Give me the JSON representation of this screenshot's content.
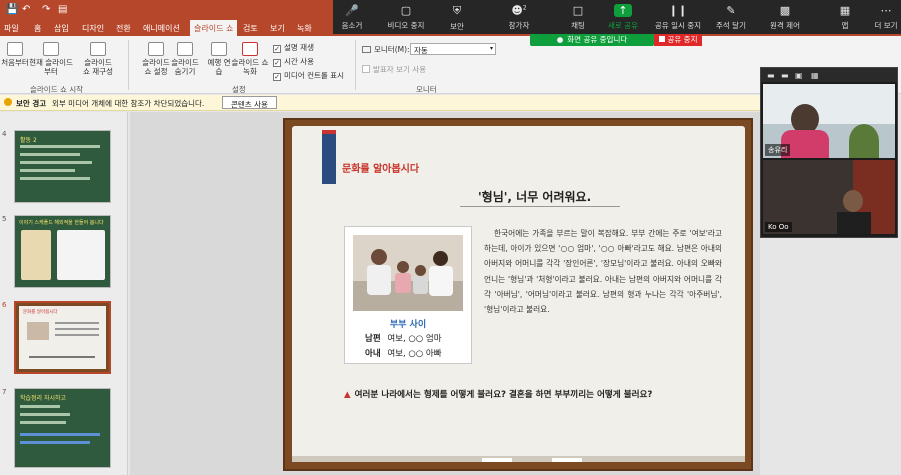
{
  "ribbon": {
    "tabs": [
      {
        "label": "파일"
      },
      {
        "label": "홈"
      },
      {
        "label": "삽입"
      },
      {
        "label": "디자인"
      },
      {
        "label": "전환"
      },
      {
        "label": "애니메이션"
      },
      {
        "label": "슬라이드 쇼"
      },
      {
        "label": "검토"
      },
      {
        "label": "보기"
      },
      {
        "label": "녹화"
      }
    ],
    "buttons": {
      "from_start": "처음부터",
      "from_current": "현재 슬라이드부터",
      "custom_show": "슬라이드 쇼 재구성",
      "setup_show": "슬라이드 쇼 설정",
      "hide_slide": "슬라이드 숨기기",
      "rehearse": "예행 연습",
      "record_show": "슬라이드 쇼 녹화"
    },
    "group_labels": {
      "start": "슬라이드 쇼 시작",
      "setup": "설정",
      "monitors": "모니터"
    },
    "checks": {
      "narration": "설명 재생",
      "timings": "시간 사용",
      "media_controls": "미디어 컨트롤 표시",
      "presenter_view": "발표자 보기 사용"
    },
    "monitor_label": "모니터(M):",
    "monitor_value": "자동"
  },
  "security_bar": {
    "title": "보안 경고",
    "message": "외부 미디어 개체에 대한 참조가 차단되었습니다.",
    "button": "콘텐츠 사용"
  },
  "zoom": {
    "items": [
      {
        "label": "음소거"
      },
      {
        "label": "비디오 중지"
      },
      {
        "label": "보안"
      },
      {
        "label": "참가자"
      },
      {
        "label": "채팅"
      },
      {
        "label": "새로 공유"
      },
      {
        "label": "공유 일시 중지"
      },
      {
        "label": "주석 달기"
      },
      {
        "label": "원격 제어"
      },
      {
        "label": "앱"
      },
      {
        "label": "더 보기"
      }
    ],
    "participant_count": "2",
    "sharing_status": "화면 공유 중입니다",
    "stop_share": "공유 중지"
  },
  "thumbnails": [
    {
      "num": "4",
      "title": "활동 2"
    },
    {
      "num": "5",
      "title": "이야기 스캐폴드 해외적을 한들어 봅니다"
    },
    {
      "num": "6",
      "title": "문화를 알아봅시다"
    },
    {
      "num": "7",
      "title": "학습정리 자시하고"
    }
  ],
  "slide": {
    "banner": "문화를 알아봅시다",
    "heading": "'형님', 너무 어려워요.",
    "photo_caption": "부부 사이",
    "rows": [
      {
        "role": "남편",
        "terms": "여보, ○○ 엄마"
      },
      {
        "role": "아내",
        "terms": "여보, ○○ 아빠"
      }
    ],
    "paragraph": "한국어에는 가족을 부르는 말이 복잡해요. 부부 간에는 주로 '여보'라고 하는데, 아이가 있으면 '○○ 엄마', '○○ 아빠'라고도 해요. 남편은 아내의 아버지와 어머니를 각각 '장인어른', '장모님'이라고 불러요. 아내의 오빠와 언니는 '형님'과 '처형'이라고 불러요. 아내는 남편의 아버지와 어머니를 각각 '아버님', '어머님'이라고 불러요. 남편의 형과 누나는 각각 '아주버님', '형님'이라고 불러요.",
    "question": "여러분 나라에서는 형제를 어떻게 불러요? 결혼을 하면 부부끼리는 어떻게 불러요?"
  },
  "video": {
    "participants": [
      {
        "name": "송유리"
      },
      {
        "name": "Ko Oo"
      }
    ]
  },
  "colors": {
    "ppt_red": "#b7472a",
    "zoom_bar": "#262626",
    "zoom_green": "#0e9f3c",
    "stop_red": "#e02828",
    "chalkboard": "#2f5a3e",
    "frame_wood": "#7b4a23"
  }
}
